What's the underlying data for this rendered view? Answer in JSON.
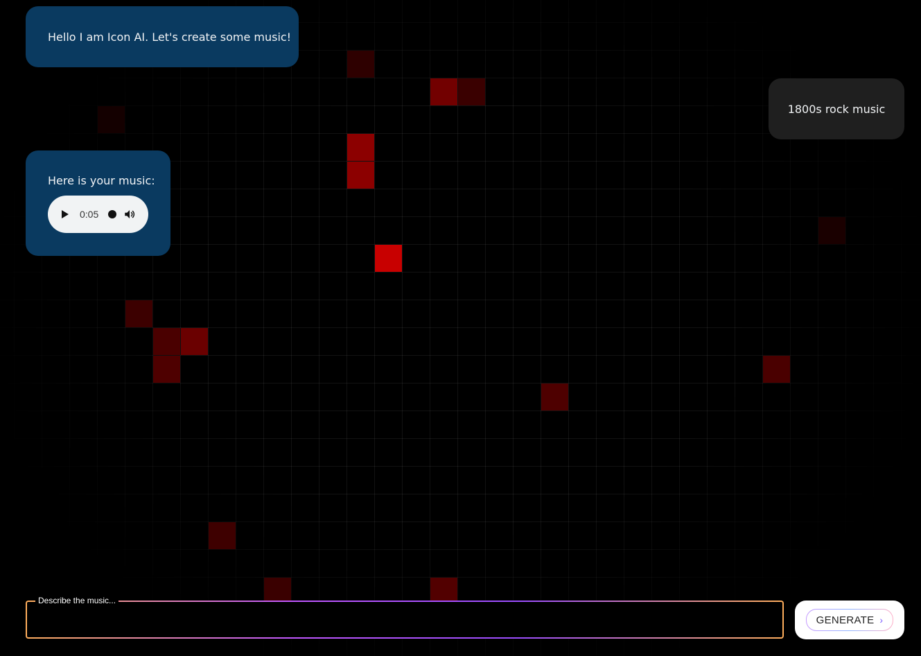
{
  "chat": {
    "greeting": "Hello I am Icon AI. Let's create some music!",
    "user_prompt": "1800s rock music",
    "response_label": "Here is your music:"
  },
  "audio": {
    "time": "0:05",
    "play_icon": "play-icon",
    "volume_icon": "volume-icon"
  },
  "prompt": {
    "legend": "Describe the music...",
    "value": ""
  },
  "generate": {
    "label": "GENERATE",
    "icon": "chevron-right-icon"
  },
  "colors": {
    "background": "#000000",
    "bot_bubble": "#0a3a60",
    "user_bubble": "#1f1f1f",
    "grid_highlight": "#c80000",
    "input_border_from": "#ffae5c",
    "input_border_to": "#9b4dff"
  }
}
